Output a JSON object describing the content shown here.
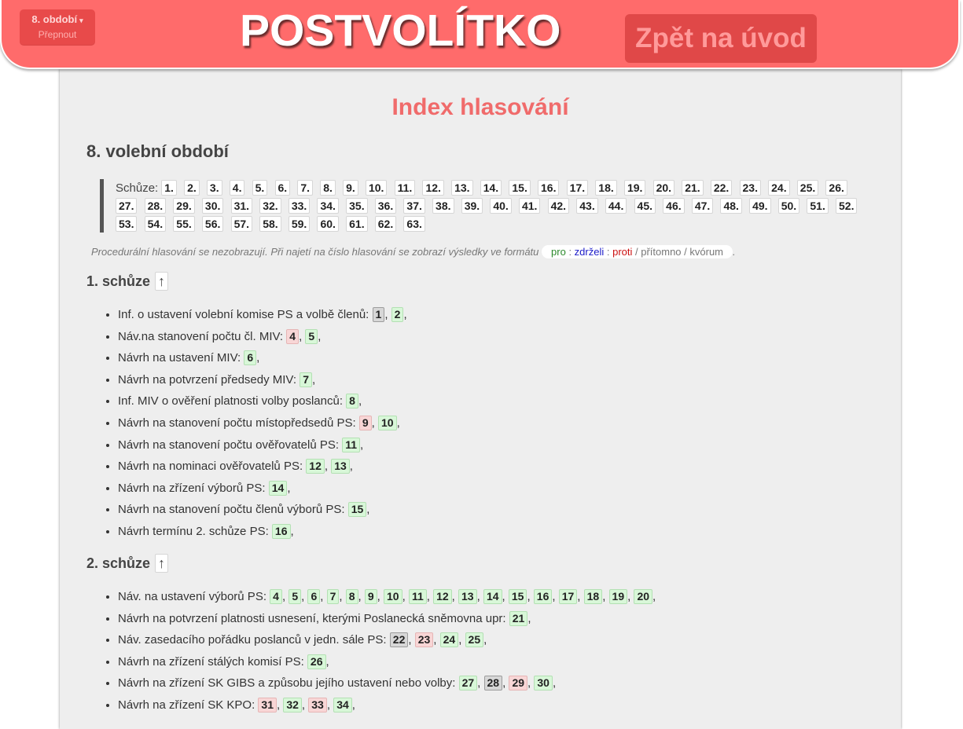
{
  "header": {
    "term_label": "8. období",
    "term_switch": "Přepnout",
    "logo": "POSTVOLÍTKO",
    "back_label": "Zpět na úvod"
  },
  "main": {
    "title": "Index hlasování",
    "term_heading": "8. volební období",
    "sessions_label": "Schůze:",
    "sessions": [
      "1.",
      "2.",
      "3.",
      "4.",
      "5.",
      "6.",
      "7.",
      "8.",
      "9.",
      "10.",
      "11.",
      "12.",
      "13.",
      "14.",
      "15.",
      "16.",
      "17.",
      "18.",
      "19.",
      "20.",
      "21.",
      "22.",
      "23.",
      "24.",
      "25.",
      "26.",
      "27.",
      "28.",
      "29.",
      "30.",
      "31.",
      "32.",
      "33.",
      "34.",
      "35.",
      "36.",
      "37.",
      "38.",
      "39.",
      "40.",
      "41.",
      "42.",
      "43.",
      "44.",
      "45.",
      "46.",
      "47.",
      "48.",
      "49.",
      "50.",
      "51.",
      "52.",
      "53.",
      "54.",
      "55.",
      "56.",
      "57.",
      "58.",
      "59.",
      "60.",
      "61.",
      "62.",
      "63."
    ],
    "note": "Procedurální hlasování se nezobrazují. Při najetí na číslo hlasování se zobrazí výsledky ve formátu",
    "legend": {
      "pro": "pro",
      "zdrzeli": "zdrželi",
      "proti": "proti",
      "pritomno": "přítomno",
      "kvorum": "kvórum",
      "sep_colon": " : ",
      "sep_slash": " / "
    },
    "note_end": "."
  },
  "colors": {
    "header_bg": "#ff6b6b",
    "title": "#f06b6b",
    "vote_pass": "#d8f7d8",
    "vote_fail": "#f8d6d6",
    "vote_quorum": "#d7d7d7"
  },
  "up_arrow": "↑",
  "sections": [
    {
      "heading": "1. schůze",
      "items": [
        {
          "label": "Inf. o ustavení volební komise PS a volbě členů:",
          "votes": [
            {
              "n": "1",
              "s": "quorum"
            },
            {
              "n": "2",
              "s": "pass"
            }
          ]
        },
        {
          "label": "Náv.na stanovení počtu čl. MIV:",
          "votes": [
            {
              "n": "4",
              "s": "fail"
            },
            {
              "n": "5",
              "s": "pass"
            }
          ]
        },
        {
          "label": "Návrh na ustavení MIV:",
          "votes": [
            {
              "n": "6",
              "s": "pass"
            }
          ]
        },
        {
          "label": "Návrh na potvrzení předsedy MIV:",
          "votes": [
            {
              "n": "7",
              "s": "pass"
            }
          ]
        },
        {
          "label": "Inf. MIV o ověření platnosti volby poslanců:",
          "votes": [
            {
              "n": "8",
              "s": "pass"
            }
          ]
        },
        {
          "label": "Návrh na stanovení počtu místopředsedů PS:",
          "votes": [
            {
              "n": "9",
              "s": "fail"
            },
            {
              "n": "10",
              "s": "pass"
            }
          ]
        },
        {
          "label": "Návrh na stanovení počtu ověřovatelů PS:",
          "votes": [
            {
              "n": "11",
              "s": "pass"
            }
          ]
        },
        {
          "label": "Návrh na nominaci ověřovatelů PS:",
          "votes": [
            {
              "n": "12",
              "s": "pass"
            },
            {
              "n": "13",
              "s": "pass"
            }
          ]
        },
        {
          "label": "Návrh na zřízení výborů PS:",
          "votes": [
            {
              "n": "14",
              "s": "pass"
            }
          ]
        },
        {
          "label": "Návrh na stanovení počtu členů výborů PS:",
          "votes": [
            {
              "n": "15",
              "s": "pass"
            }
          ]
        },
        {
          "label": "Návrh termínu 2. schůze PS:",
          "votes": [
            {
              "n": "16",
              "s": "pass"
            }
          ]
        }
      ]
    },
    {
      "heading": "2. schůze",
      "items": [
        {
          "label": "Náv. na ustavení výborů PS:",
          "votes": [
            {
              "n": "4",
              "s": "pass"
            },
            {
              "n": "5",
              "s": "pass"
            },
            {
              "n": "6",
              "s": "pass"
            },
            {
              "n": "7",
              "s": "pass"
            },
            {
              "n": "8",
              "s": "pass"
            },
            {
              "n": "9",
              "s": "pass"
            },
            {
              "n": "10",
              "s": "pass"
            },
            {
              "n": "11",
              "s": "pass"
            },
            {
              "n": "12",
              "s": "pass"
            },
            {
              "n": "13",
              "s": "pass"
            },
            {
              "n": "14",
              "s": "pass"
            },
            {
              "n": "15",
              "s": "pass"
            },
            {
              "n": "16",
              "s": "pass"
            },
            {
              "n": "17",
              "s": "pass"
            },
            {
              "n": "18",
              "s": "pass"
            },
            {
              "n": "19",
              "s": "pass"
            },
            {
              "n": "20",
              "s": "pass"
            }
          ]
        },
        {
          "label": "Návrh na potvrzení platnosti usnesení, kterými Poslanecká sněmovna upr:",
          "votes": [
            {
              "n": "21",
              "s": "pass"
            }
          ]
        },
        {
          "label": "Náv. zasedacího pořádku poslanců v jedn. sále PS:",
          "votes": [
            {
              "n": "22",
              "s": "quorum"
            },
            {
              "n": "23",
              "s": "fail"
            },
            {
              "n": "24",
              "s": "pass"
            },
            {
              "n": "25",
              "s": "pass"
            }
          ]
        },
        {
          "label": "Návrh na zřízení stálých komisí PS:",
          "votes": [
            {
              "n": "26",
              "s": "pass"
            }
          ]
        },
        {
          "label": "Návrh na zřízení SK GIBS a způsobu jejího ustavení nebo volby:",
          "votes": [
            {
              "n": "27",
              "s": "pass"
            },
            {
              "n": "28",
              "s": "quorum"
            },
            {
              "n": "29",
              "s": "fail"
            },
            {
              "n": "30",
              "s": "pass"
            }
          ]
        },
        {
          "label": "Návrh na zřízení SK KPO:",
          "votes": [
            {
              "n": "31",
              "s": "fail"
            },
            {
              "n": "32",
              "s": "pass"
            },
            {
              "n": "33",
              "s": "fail"
            },
            {
              "n": "34",
              "s": "pass"
            }
          ]
        }
      ]
    }
  ]
}
